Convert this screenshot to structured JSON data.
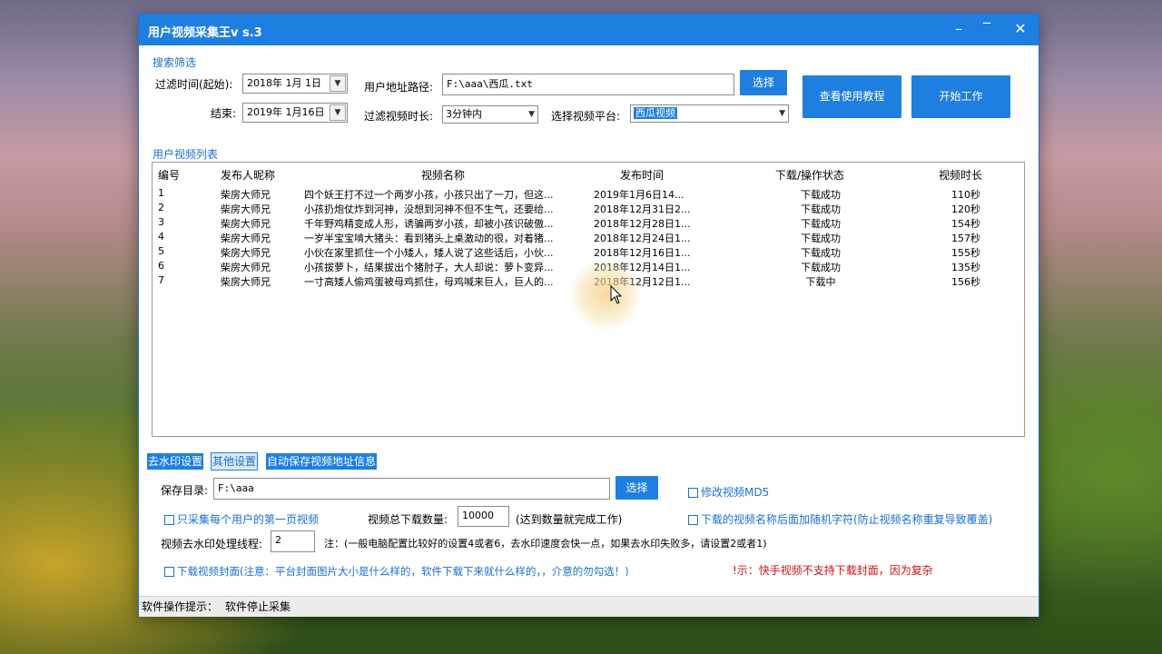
{
  "window": {
    "title": "用户视频采集王v s.3",
    "minimize": "–",
    "maximize": "‾",
    "close": "✕"
  },
  "search": {
    "section_label": "搜索筛选",
    "start_label": "过滤时间(起始):",
    "start_value": "2018年  1月  1日",
    "end_label": "结束:",
    "end_value": "2019年  1月16日",
    "path_label": "用户地址路径:",
    "path_value": "F:\\aaa\\西瓜.txt",
    "select_button": "选择",
    "duration_label": "过滤视频时长:",
    "duration_value": "3分钟内",
    "platform_label": "选择视频平台:",
    "platform_value": "西瓜视频",
    "tutorial_button": "查看使用教程",
    "start_button": "开始工作"
  },
  "list": {
    "section_label": "用户视频列表",
    "columns": [
      "编号",
      "发布人昵称",
      "视频名称",
      "发布时间",
      "下载/操作状态",
      "视频时长"
    ],
    "rows": [
      {
        "id": "1",
        "author": "柴房大师兄",
        "name": "四个妖王打不过一个两岁小孩，小孩只出了一刀，但这...",
        "time": "2019年1月6日14...",
        "status": "下载成功",
        "duration": "110秒"
      },
      {
        "id": "2",
        "author": "柴房大师兄",
        "name": "小孩扔炮仗炸到河神，没想到河神不但不生气，还要给...",
        "time": "2018年12月31日2...",
        "status": "下载成功",
        "duration": "120秒"
      },
      {
        "id": "3",
        "author": "柴房大师兄",
        "name": "千年野鸡精变成人形，诱骗两岁小孩，却被小孩识破傲...",
        "time": "2018年12月28日1...",
        "status": "下载成功",
        "duration": "154秒"
      },
      {
        "id": "4",
        "author": "柴房大师兄",
        "name": "一岁半宝宝啃大猪头：看到猪头上桌激动的很，对着猪...",
        "time": "2018年12月24日1...",
        "status": "下载成功",
        "duration": "157秒"
      },
      {
        "id": "5",
        "author": "柴房大师兄",
        "name": "小伙在家里抓住一个小矮人，矮人说了这些话后，小伙...",
        "time": "2018年12月16日1...",
        "status": "下载成功",
        "duration": "155秒"
      },
      {
        "id": "6",
        "author": "柴房大师兄",
        "name": "小孩拔萝卜，结果拔出个猪肘子，大人却说：萝卜变异...",
        "time": "2018年12月14日1...",
        "status": "下载成功",
        "duration": "135秒"
      },
      {
        "id": "7",
        "author": "柴房大师兄",
        "name": "一寸高矮人偷鸡蛋被母鸡抓住，母鸡喊来巨人，巨人的...",
        "time": "2018年12月12日1...",
        "status": "下载中",
        "duration": "156秒"
      }
    ]
  },
  "tabs": [
    "去水印设置",
    "其他设置",
    "自动保存视频地址信息"
  ],
  "settings": {
    "save_dir_label": "保存目录:",
    "save_dir_value": "F:\\aaa",
    "select_button": "选择",
    "md5_label": "修改视频MD5",
    "first_page_label": "只采集每个用户的第一页视频",
    "total_label": "视频总下载数量:",
    "total_value": "10000",
    "total_note": "(达到数量就完成工作)",
    "random_label": "下载的视频名称后面加随机字符(防止视频名称重复导致覆盖)",
    "threads_label": "视频去水印处理线程:",
    "threads_value": "2",
    "threads_note": "注：(一般电脑配置比较好的设置4或者6，去水印速度会快一点，如果去水印失败多，请设置2或者1)",
    "cover_label": "下载视频封面(注意：平台封面图片大小是什么样的，软件下载下来就什么样的，，介意的勿勾选！)",
    "warning": "!示：快手视频不支持下载封面，因为复杂"
  },
  "status": {
    "label": "软件操作提示：",
    "value": "软件停止采集"
  },
  "colors": {
    "accent": "#1e7fe0",
    "label_blue": "#1a6fd4",
    "warning_red": "#d01010"
  }
}
